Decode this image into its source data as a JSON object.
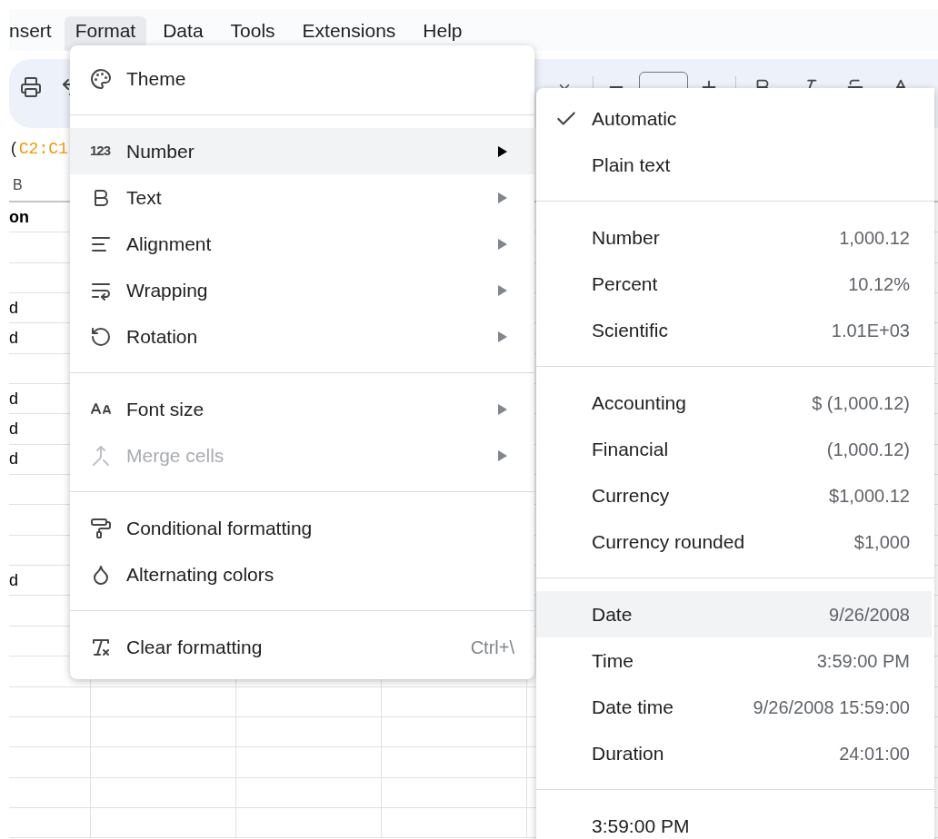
{
  "menubar": [
    {
      "label": "nsert",
      "selected": false
    },
    {
      "label": "Format",
      "selected": true
    },
    {
      "label": "Data",
      "selected": false
    },
    {
      "label": "Tools",
      "selected": false
    },
    {
      "label": "Extensions",
      "selected": false
    },
    {
      "label": "Help",
      "selected": false
    }
  ],
  "formula": {
    "prefix": "(",
    "range": "C2:C1"
  },
  "sheet": {
    "column_header": "B",
    "header_cell": "on",
    "rows": [
      {},
      {},
      {
        "cell": "d"
      },
      {
        "cell": "d"
      },
      {},
      {
        "cell": "d"
      },
      {
        "cell": "d"
      },
      {
        "cell": "d"
      },
      {},
      {},
      {},
      {
        "cell": "d"
      },
      {},
      {},
      {},
      {},
      {},
      {},
      {},
      {}
    ]
  },
  "format_menu": {
    "sections": [
      {
        "items": [
          {
            "label": "Theme",
            "has_submenu": false,
            "disabled": false,
            "highlighted": false
          }
        ]
      },
      {
        "items": [
          {
            "label": "Number",
            "icon_text": "123",
            "has_submenu": true,
            "disabled": false,
            "highlighted": true
          },
          {
            "label": "Text",
            "has_submenu": true,
            "disabled": false,
            "highlighted": false
          },
          {
            "label": "Alignment",
            "has_submenu": true,
            "disabled": false,
            "highlighted": false
          },
          {
            "label": "Wrapping",
            "has_submenu": true,
            "disabled": false,
            "highlighted": false
          },
          {
            "label": "Rotation",
            "has_submenu": true,
            "disabled": false,
            "highlighted": false
          }
        ]
      },
      {
        "items": [
          {
            "label": "Font size",
            "has_submenu": true,
            "disabled": false,
            "highlighted": false
          },
          {
            "label": "Merge cells",
            "has_submenu": true,
            "disabled": true,
            "highlighted": false
          }
        ]
      },
      {
        "items": [
          {
            "label": "Conditional formatting",
            "has_submenu": false,
            "disabled": false,
            "highlighted": false
          },
          {
            "label": "Alternating colors",
            "has_submenu": false,
            "disabled": false,
            "highlighted": false
          }
        ]
      },
      {
        "items": [
          {
            "label": "Clear formatting",
            "has_submenu": false,
            "disabled": false,
            "highlighted": false,
            "shortcut": "Ctrl+\\"
          }
        ]
      }
    ]
  },
  "number_submenu": {
    "sections": [
      {
        "items": [
          {
            "label": "Automatic",
            "checked": true,
            "highlighted": false
          },
          {
            "label": "Plain text",
            "checked": false,
            "highlighted": false
          }
        ]
      },
      {
        "items": [
          {
            "label": "Number",
            "example": "1,000.12",
            "checked": false,
            "highlighted": false
          },
          {
            "label": "Percent",
            "example": "10.12%",
            "checked": false,
            "highlighted": false
          },
          {
            "label": "Scientific",
            "example": "1.01E+03",
            "checked": false,
            "highlighted": false
          }
        ]
      },
      {
        "items": [
          {
            "label": "Accounting",
            "example": "$ (1,000.12)",
            "checked": false,
            "highlighted": false
          },
          {
            "label": "Financial",
            "example": "(1,000.12)",
            "checked": false,
            "highlighted": false
          },
          {
            "label": "Currency",
            "example": "$1,000.12",
            "checked": false,
            "highlighted": false
          },
          {
            "label": "Currency rounded",
            "example": "$1,000",
            "checked": false,
            "highlighted": false
          }
        ]
      },
      {
        "items": [
          {
            "label": "Date",
            "example": "9/26/2008",
            "checked": false,
            "highlighted": true
          },
          {
            "label": "Time",
            "example": "3:59:00 PM",
            "checked": false,
            "highlighted": false
          },
          {
            "label": "Date time",
            "example": "9/26/2008 15:59:00",
            "checked": false,
            "highlighted": false
          },
          {
            "label": "Duration",
            "example": "24:01:00",
            "checked": false,
            "highlighted": false
          }
        ]
      },
      {
        "items": [
          {
            "label": "3:59:00 PM",
            "checked": false,
            "highlighted": false
          }
        ]
      }
    ]
  }
}
